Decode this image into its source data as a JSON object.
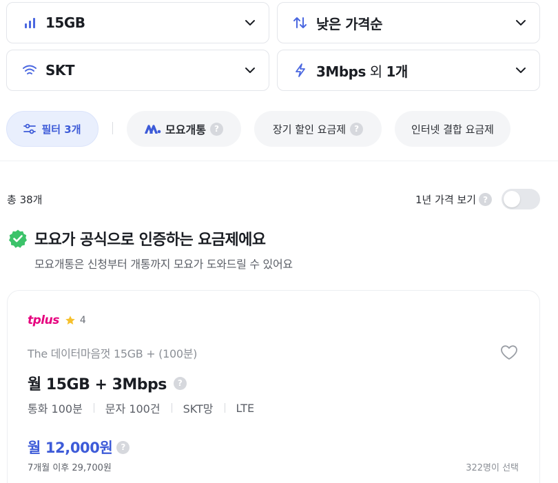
{
  "selects": {
    "data": {
      "value": "15GB",
      "icon": "signal-bars-icon"
    },
    "sort": {
      "value": "낮은 가격순",
      "icon": "sort-arrows-icon"
    },
    "carrier": {
      "value": "SKT",
      "icon": "wifi-icon"
    },
    "speed": {
      "value_bold": "3Mbps",
      "value_light": " 외 ",
      "value_bold2": "1개",
      "icon": "lightning-icon"
    }
  },
  "chips": {
    "filter": "필터 3개",
    "moyo": "모요개통",
    "long_discount": "장기 할인 요금제",
    "internet_combo": "인터넷 결합 요금제"
  },
  "list": {
    "total": "총 38개",
    "yearly_label": "1년 가격 보기"
  },
  "certified": {
    "title": "모요가 공식으로 인증하는 요금제에요",
    "subtitle": "모요개통은 신청부터 개통까지 모요가 도와드릴 수 있어요"
  },
  "plan_card": {
    "brand": "tplus",
    "rating": "4",
    "plan_name": "The 데이터마음껏 15GB + (100분)",
    "headline": "월 15GB + 3Mbps",
    "specs": [
      "통화 100분",
      "문자 100건",
      "SKT망",
      "LTE"
    ],
    "price": "월 12,000원",
    "after_price": "7개월 이후 29,700원",
    "selected_count": "322명이 선택"
  },
  "colors": {
    "accent": "#3d5bd8",
    "brand_pink": "#e6007e",
    "check_green": "#3cc36a",
    "star_yellow": "#f6c02c"
  }
}
